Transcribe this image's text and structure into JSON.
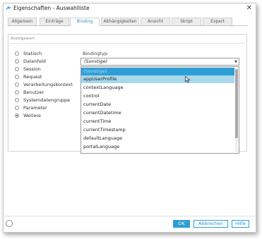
{
  "window": {
    "title": "Eigenschaften - Auswahlliste",
    "close_label": "✕"
  },
  "tabs": [
    {
      "label": "Allgemein",
      "active": false
    },
    {
      "label": "Einträge",
      "active": false
    },
    {
      "label": "Binding",
      "active": true
    },
    {
      "label": "Abhängigkeiten",
      "active": false
    },
    {
      "label": "Ansicht",
      "active": false
    },
    {
      "label": "Skript",
      "active": false
    },
    {
      "label": "Expert",
      "active": false
    }
  ],
  "group": {
    "title": "Anzeigewert"
  },
  "radio_options": [
    {
      "label": "Statisch",
      "checked": false
    },
    {
      "label": "Datenfeld",
      "checked": false
    },
    {
      "label": "Session",
      "checked": false
    },
    {
      "label": "Request",
      "checked": false
    },
    {
      "label": "Verarbeitungskontext",
      "checked": false
    },
    {
      "label": "Benutzer",
      "checked": false
    },
    {
      "label": "Systemdatengruppe",
      "checked": false
    },
    {
      "label": "Parameter",
      "checked": false
    },
    {
      "label": "Weitere",
      "checked": true
    }
  ],
  "binding_type": {
    "label": "Bindingtyp",
    "value": "(Sonstige)",
    "options": [
      {
        "label": "(Sonstige)",
        "state": "selected"
      },
      {
        "label": "appUserProfile",
        "state": "hover"
      },
      {
        "label": "contextLanguage",
        "state": ""
      },
      {
        "label": "control",
        "state": ""
      },
      {
        "label": "currentDate",
        "state": ""
      },
      {
        "label": "currentDatetime",
        "state": ""
      },
      {
        "label": "currentTime",
        "state": ""
      },
      {
        "label": "currentTimestamp",
        "state": ""
      },
      {
        "label": "defaultLanguage",
        "state": ""
      },
      {
        "label": "portalLanguage",
        "state": ""
      }
    ]
  },
  "footer": {
    "ok_label": "OK",
    "cancel_label": "Abbrechen",
    "help_label": "Hilfe"
  },
  "colors": {
    "accent": "#2f9ed6",
    "hover": "#a8d8ec"
  }
}
